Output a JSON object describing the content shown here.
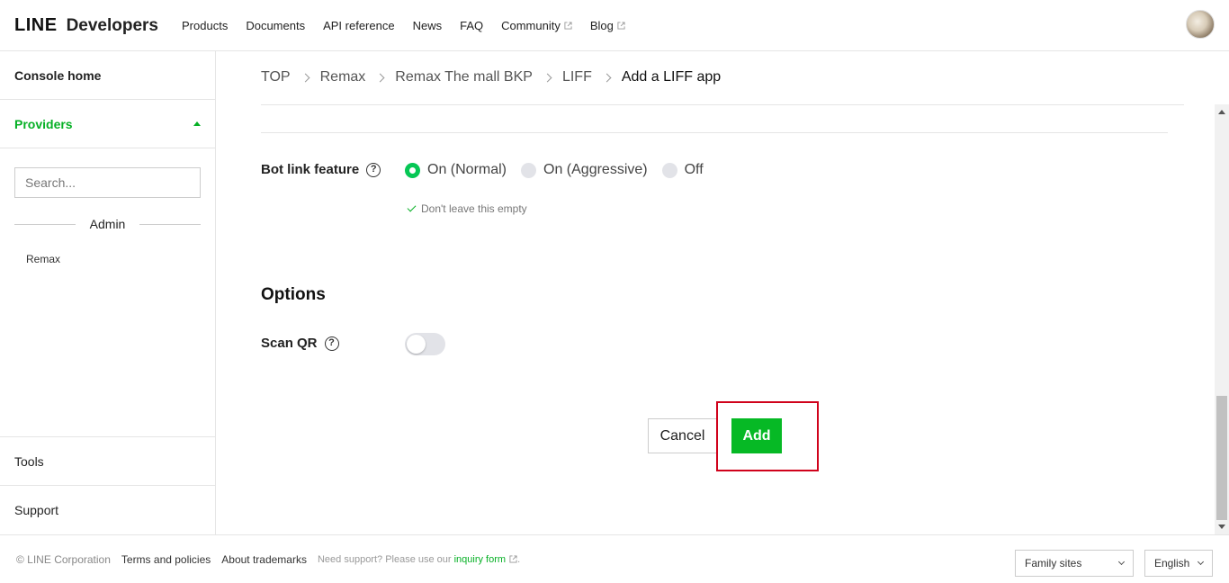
{
  "header": {
    "logo_line": "LINE",
    "logo_dev": "Developers",
    "nav": [
      {
        "label": "Products",
        "external": false
      },
      {
        "label": "Documents",
        "external": false
      },
      {
        "label": "API reference",
        "external": false
      },
      {
        "label": "News",
        "external": false
      },
      {
        "label": "FAQ",
        "external": false
      },
      {
        "label": "Community",
        "external": true
      },
      {
        "label": "Blog",
        "external": true
      }
    ]
  },
  "sidebar": {
    "console_home": "Console home",
    "providers": "Providers",
    "search_placeholder": "Search...",
    "section_label": "Admin",
    "provider_items": [
      "Remax"
    ],
    "tools": "Tools",
    "support": "Support"
  },
  "breadcrumb": [
    "TOP",
    "Remax",
    "Remax The mall BKP",
    "LIFF",
    "Add a LIFF app"
  ],
  "bot_link": {
    "label": "Bot link feature",
    "options": [
      {
        "label": "On (Normal)",
        "selected": true
      },
      {
        "label": "On (Aggressive)",
        "selected": false
      },
      {
        "label": "Off",
        "selected": false
      }
    ],
    "hint": "Don't leave this empty"
  },
  "options": {
    "title": "Options",
    "scan_qr_label": "Scan QR",
    "scan_qr_enabled": false
  },
  "actions": {
    "cancel": "Cancel",
    "add": "Add"
  },
  "footer": {
    "copyright": "© LINE Corporation",
    "terms": "Terms and policies",
    "trademarks": "About trademarks",
    "support_text": "Need support? Please use our",
    "inquiry": "inquiry form",
    "period": ".",
    "family_sites": "Family sites",
    "language": "English"
  },
  "colors": {
    "brand_green": "#06b925",
    "highlight_red": "#d0021b"
  }
}
